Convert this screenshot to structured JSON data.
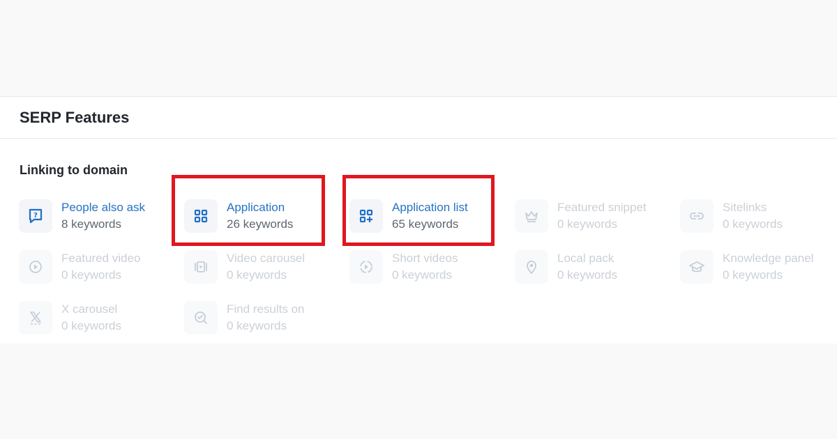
{
  "panel": {
    "title": "SERP Features",
    "section_title": "Linking to domain"
  },
  "features": [
    {
      "name": "People also ask",
      "count": "8 keywords",
      "icon": "question-bubble-icon",
      "active": true
    },
    {
      "name": "Application",
      "count": "26 keywords",
      "icon": "app-grid-icon",
      "active": true
    },
    {
      "name": "Application list",
      "count": "65 keywords",
      "icon": "app-grid-plus-icon",
      "active": true
    },
    {
      "name": "Featured snippet",
      "count": "0 keywords",
      "icon": "crown-icon",
      "active": false
    },
    {
      "name": "Sitelinks",
      "count": "0 keywords",
      "icon": "link-icon",
      "active": false
    },
    {
      "name": "Featured video",
      "count": "0 keywords",
      "icon": "play-circle-icon",
      "active": false
    },
    {
      "name": "Video carousel",
      "count": "0 keywords",
      "icon": "video-carousel-icon",
      "active": false
    },
    {
      "name": "Short videos",
      "count": "0 keywords",
      "icon": "short-video-icon",
      "active": false
    },
    {
      "name": "Local pack",
      "count": "0 keywords",
      "icon": "map-pin-icon",
      "active": false
    },
    {
      "name": "Knowledge panel",
      "count": "0 keywords",
      "icon": "graduation-cap-icon",
      "active": false
    },
    {
      "name": "X carousel",
      "count": "0 keywords",
      "icon": "x-logo-icon",
      "active": false
    },
    {
      "name": "Find results on",
      "count": "0 keywords",
      "icon": "search-check-icon",
      "active": false
    }
  ],
  "colors": {
    "active_name": "#2672c4",
    "active_icon": "#1f6fc4",
    "disabled": "#cbd0d6",
    "highlight_border": "#e0171f"
  }
}
